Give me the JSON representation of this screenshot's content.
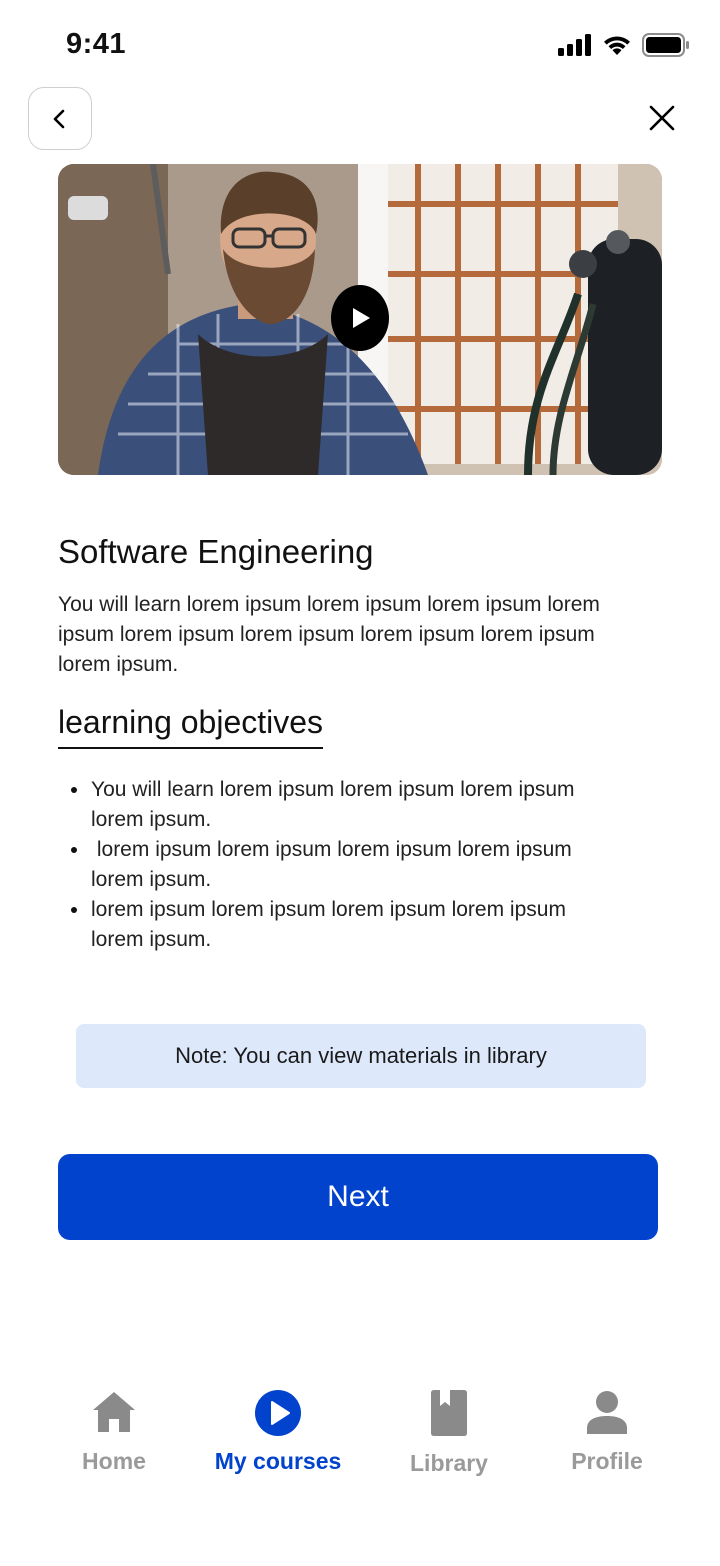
{
  "status_bar": {
    "time": "9:41"
  },
  "header": {
    "back_icon": "chevron-left-icon",
    "close_icon": "close-icon"
  },
  "video": {
    "thumbnail": "man in plaid shirt and apron in workshop",
    "play_icon": "play-icon"
  },
  "course": {
    "title": "Software Engineering",
    "description": "You will learn lorem ipsum lorem ipsum lorem ipsum lorem ipsum lorem ipsum lorem ipsum lorem ipsum lorem ipsum lorem ipsum."
  },
  "objectives": {
    "heading": "learning objectives",
    "items": [
      "You will learn lorem ipsum lorem ipsum lorem ipsum lorem ipsum.",
      " lorem ipsum lorem ipsum lorem ipsum lorem ipsum lorem ipsum.",
      "lorem ipsum lorem ipsum lorem ipsum lorem ipsum lorem ipsum."
    ]
  },
  "note": "Note: You can view materials in library",
  "next_button": "Next",
  "tabbar": {
    "items": [
      {
        "label": "Home",
        "icon": "home-icon",
        "active": false
      },
      {
        "label": "My courses",
        "icon": "play-circle-icon",
        "active": true
      },
      {
        "label": "Library",
        "icon": "book-icon",
        "active": false
      },
      {
        "label": "Profile",
        "icon": "user-icon",
        "active": false
      }
    ]
  },
  "colors": {
    "primary": "#0143cc",
    "note_bg": "#dde9fb",
    "inactive": "#9a9a9a"
  }
}
